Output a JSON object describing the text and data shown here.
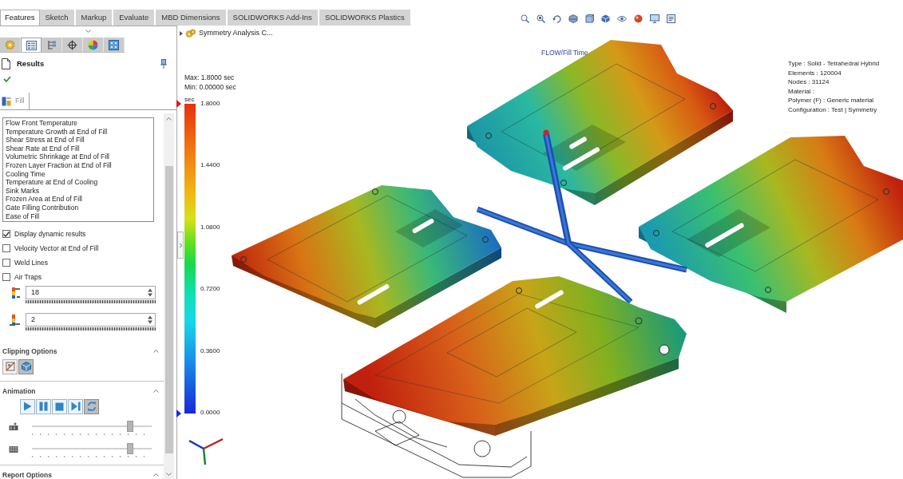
{
  "ribbon_tabs": [
    {
      "label": "Features",
      "selected": true
    },
    {
      "label": "Sketch",
      "selected": false
    },
    {
      "label": "Markup",
      "selected": false
    },
    {
      "label": "Evaluate",
      "selected": false
    },
    {
      "label": "MBD Dimensions",
      "selected": false
    },
    {
      "label": "SOLIDWORKS Add-Ins",
      "selected": false
    },
    {
      "label": "SOLIDWORKS Plastics",
      "selected": false
    }
  ],
  "manager_tabs": [
    {
      "kind": "feature",
      "selected": false
    },
    {
      "kind": "property",
      "selected": true
    },
    {
      "kind": "configuration",
      "selected": false
    },
    {
      "kind": "dimxpert",
      "selected": false
    },
    {
      "kind": "display",
      "selected": false
    },
    {
      "kind": "plastics",
      "selected": false
    }
  ],
  "property_manager": {
    "title": "Results",
    "result_tab": "Fill",
    "results": [
      "Flow Front Temperature",
      "Temperature Growth at End of Fill",
      "Shear Stress at End of Fill",
      "Shear Rate at End of Fill",
      "Volumetric Shrinkage at End of Fill",
      "Frozen Layer Fraction at End of Fill",
      "Cooling Time",
      "Temperature at End of Cooling",
      "Sink Marks",
      "Frozen Area at End of Fill",
      "Gate Filling Contribution",
      "Ease of Fill"
    ],
    "options": [
      {
        "label": "Display dynamic results",
        "checked": true
      },
      {
        "label": "Velocity Vector at End of Fill",
        "checked": false
      },
      {
        "label": "Weld Lines",
        "checked": false
      },
      {
        "label": "Air Traps",
        "checked": false
      }
    ],
    "scale_fields": [
      {
        "kind": "max",
        "value": "18"
      },
      {
        "kind": "min",
        "value": "2"
      }
    ]
  },
  "clipping_options": {
    "title": "Clipping Options",
    "buttons": [
      {
        "kind": "plane",
        "selected": false
      },
      {
        "kind": "cube",
        "selected": true
      }
    ]
  },
  "animation": {
    "title": "Animation",
    "buttons": [
      {
        "kind": "play",
        "selected": false
      },
      {
        "kind": "pause",
        "selected": false
      },
      {
        "kind": "stop",
        "selected": false
      },
      {
        "kind": "step",
        "selected": false
      },
      {
        "kind": "loop",
        "selected": true
      }
    ],
    "sliders": [
      {
        "kind": "speed",
        "level": 0.82
      },
      {
        "kind": "frames",
        "level": 0.82
      }
    ]
  },
  "report_options": {
    "title": "Report Options"
  },
  "viewport": {
    "tree_item": "Symmetry Analysis C...",
    "max_label": "Max: 1.8000 sec",
    "min_label": "Min: 0.00000 sec",
    "legend": {
      "unit": "sec",
      "ticks": [
        "1.8000",
        "1.4400",
        "1.0800",
        "0.7200",
        "0.3600",
        "0.0000"
      ]
    },
    "plot_title": "FLOW/Fill Time",
    "info": [
      "Type : Solid - Tetrahedral Hybrid",
      "Elements : 120004",
      "Nodes : 31124",
      "Material :",
      "Polymer (F) : Generic material",
      "Configuration : Test | Symmetry"
    ]
  }
}
